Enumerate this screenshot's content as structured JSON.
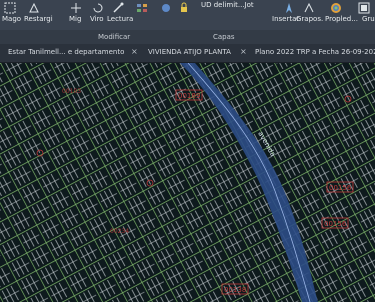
{
  "ribbon": {
    "buttons": {
      "mago": "Mago",
      "restargi": "Restargi",
      "mig": "Mig",
      "viro": "Viro",
      "lectura": "Lectura",
      "layer_dropdown": "UD delimit...Jot",
      "insertar": "Insertar",
      "grupos": "Grapos.",
      "propiedades": "Propled...",
      "grupo_trunc": "Grui"
    },
    "panels": {
      "modificar": "Modificar",
      "capas": "Capas"
    }
  },
  "tabs": [
    {
      "label": "Estar Tanilmell... e departamento",
      "close": "×"
    },
    {
      "label": "VIVIENDA ATIJO PLANTA",
      "close": "×"
    },
    {
      "label": "Plano 2022 TRP a Fecha 26-09-2022.",
      "close": ""
    }
  ],
  "map": {
    "street_label": "avenida",
    "red_labels": [
      "00189",
      "00156",
      "00156",
      "00138",
      "00103",
      "00234"
    ]
  },
  "colors": {
    "ribbon_bg": "#3a4350",
    "canvas_bg": "#0e1a1d",
    "street_green": "#7db36a",
    "road_blue": "#2c4c86",
    "label_red": "#c23a3a"
  }
}
